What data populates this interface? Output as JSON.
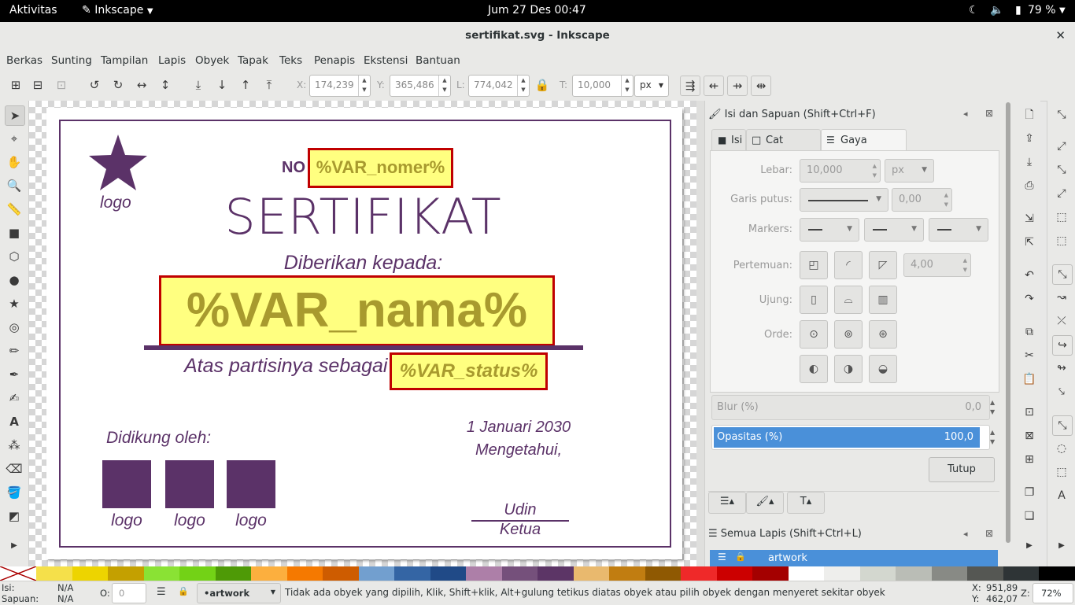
{
  "topbar": {
    "activities": "Aktivitas",
    "app": "Inkscape",
    "datetime": "Jum 27 Des  00:47",
    "battery": "79 %"
  },
  "window": {
    "title": "sertifikat.svg - Inkscape",
    "close": "✕"
  },
  "menu": [
    "Berkas",
    "Sunting",
    "Tampilan",
    "Lapis",
    "Obyek",
    "Tapak",
    "Teks",
    "Penapis",
    "Ekstensi",
    "Bantuan"
  ],
  "controls": {
    "x_label": "X:",
    "x_value": "174,239",
    "y_label": "Y:",
    "y_value": "365,486",
    "w_label": "L:",
    "w_value": "774,042",
    "h_label": "T:",
    "h_value": "10,000",
    "unit": "px"
  },
  "certificate": {
    "logo_top": "logo",
    "no_label": "NO",
    "var_nomer": "%VAR_nomer%",
    "title": "SERTIFIKAT",
    "given_to": "Diberikan kepada:",
    "var_nama": "%VAR_nama%",
    "participation": "Atas partisinya sebagai",
    "var_status": "%VAR_status%",
    "supported_by": "Didikung oleh:",
    "sponsor_logos": [
      "logo",
      "logo",
      "logo"
    ],
    "date": "1 Januari 2030",
    "acknowledged": "Mengetahui,",
    "signer_name": "Udin",
    "signer_role": "Ketua"
  },
  "fill_stroke": {
    "title": "Isi dan Sapuan (Shift+Ctrl+F)",
    "tabs": [
      "Isi",
      "Cat sapuan",
      "Gaya sapuan"
    ],
    "active_tab": "Gaya sapuan",
    "width_label": "Lebar:",
    "width_value": "10,000",
    "width_unit": "px",
    "dash_label": "Garis putus:",
    "dash_offset": "0,00",
    "markers_label": "Markers:",
    "join_label": "Pertemuan:",
    "miter_value": "4,00",
    "cap_label": "Ujung:",
    "order_label": "Orde:",
    "blur_label": "Blur (%)",
    "blur_value": "0,0",
    "opacity_label": "Opasitas  (%)",
    "opacity_value": "100,0",
    "close_button": "Tutup"
  },
  "layers": {
    "title": "Semua Lapis (Shift+Ctrl+L)",
    "layer_name": "artwork"
  },
  "palette": [
    "#f5e04a",
    "#edd400",
    "#c4a000",
    "#8ae234",
    "#73d216",
    "#4e9a06",
    "#fcaf3e",
    "#f57900",
    "#ce5c00",
    "#729fcf",
    "#3465a4",
    "#204a87",
    "#ad7fa8",
    "#75507b",
    "#5c3566",
    "#e9b96e",
    "#c17d11",
    "#8f5902",
    "#ef2929",
    "#cc0000",
    "#a40000",
    "#ffffff",
    "#eeeeec",
    "#d3d7cf",
    "#babdb6",
    "#888a85",
    "#555753",
    "#2e3436",
    "#000000"
  ],
  "status": {
    "fill_label": "Isi:",
    "fill_value": "N/A",
    "stroke_label": "Sapuan:",
    "stroke_value": "N/A",
    "opacity_label": "O:",
    "opacity_value": "0",
    "layer": "•artwork",
    "message": "Tidak ada obyek yang dipilih, Klik, Shift+klik, Alt+gulung tetikus diatas obyek atau pilih obyek dengan menyeret sekitar obyek",
    "x_label": "X:",
    "x": "951,89",
    "y_label": "Y:",
    "y": "462,07",
    "zoom_label": "Z:",
    "zoom": "72%"
  },
  "colors": {
    "accent": "#4a90d9",
    "certificate_purple": "#5b3268",
    "var_fill": "#ffff80",
    "var_border": "#c00000"
  }
}
